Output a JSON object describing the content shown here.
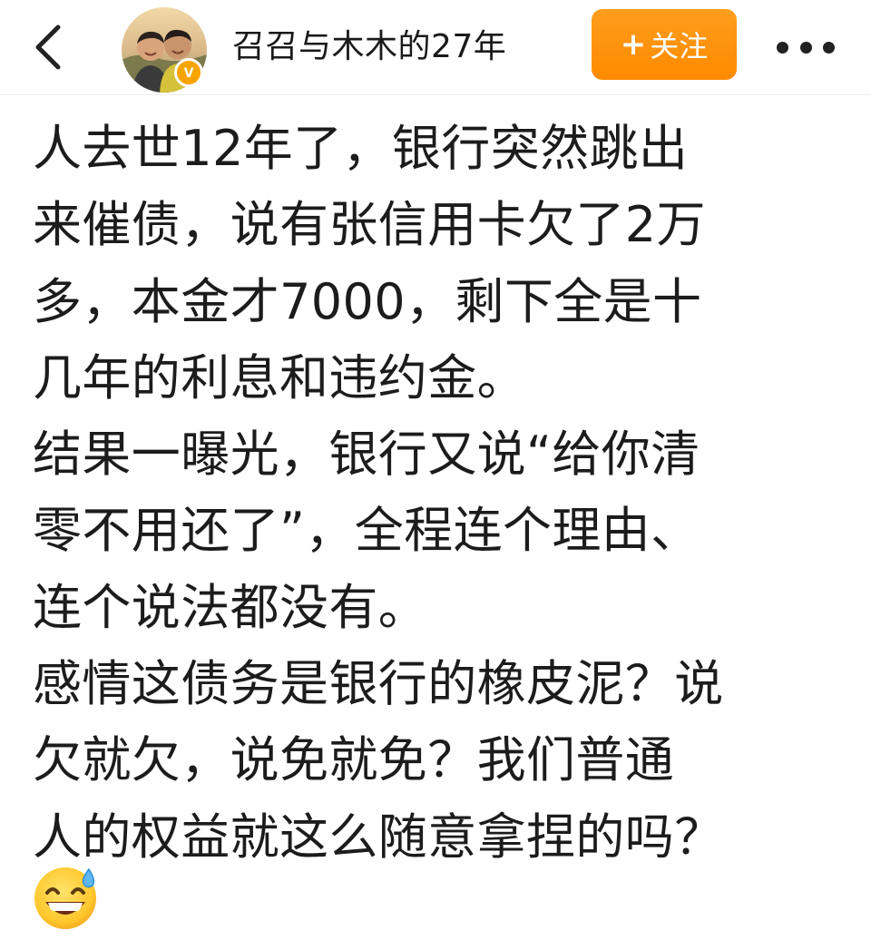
{
  "header": {
    "account_name": "召召与木木的27年",
    "follow_plus": "+",
    "follow_label": "关注",
    "verified_mark": "V"
  },
  "icons": {
    "back": "chevron-left-icon",
    "more": "more-horizontal-icon",
    "verified": "verified-badge-icon",
    "emoji": "grinning-sweat-emoji"
  },
  "colors": {
    "follow_button": "#ff8a00",
    "verified_badge": "#f7a400",
    "text": "#1c1c1c"
  },
  "post": {
    "lines": [
      "人去世12年了，银行突然跳出",
      "来催债，说有张信用卡欠了2万",
      "多，本金才7000，剩下全是十",
      "几年的利息和违约金。",
      "结果一曝光，银行又说“给你清",
      "零不用还了”，全程连个理由、",
      "连个说法都没有。",
      "感情这债务是银行的橡皮泥？说",
      "欠就欠，说免就免？我们普通",
      "人的权益就这么随意拿捏的吗？"
    ]
  }
}
